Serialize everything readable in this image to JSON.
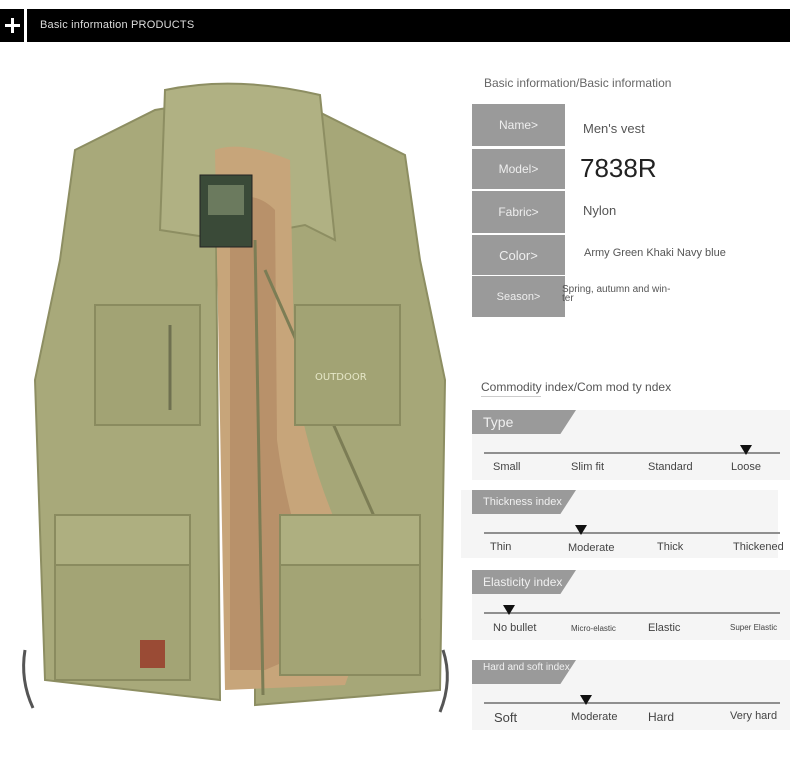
{
  "header": {
    "title": "Basic information PRODUCTS"
  },
  "basic_info": {
    "title": "Basic information/Basic information",
    "rows": [
      {
        "label": "Name>",
        "value": "Men's vest"
      },
      {
        "label": "Model>",
        "value": "7838R"
      },
      {
        "label": "Fabric>",
        "value": "Nylon"
      },
      {
        "label": "Color>",
        "value": "Army Green Khaki Navy blue"
      },
      {
        "label": "Season>",
        "value": "Spring, autumn and win-\nter"
      }
    ]
  },
  "commodity_index": {
    "title": "Commodity index/Com mod ty ndex",
    "indices": [
      {
        "name": "Type",
        "options": [
          "Small",
          "Slim fit",
          "Standard",
          "Loose"
        ],
        "selected": "Loose"
      },
      {
        "name": "Thickness index",
        "options": [
          "Thin",
          "Moderate",
          "Thick",
          "Thickened"
        ],
        "selected": "Moderate"
      },
      {
        "name": "Elasticity index",
        "options": [
          "No bullet",
          "Micro-elastic",
          "Elastic",
          "Super Elastic"
        ],
        "selected": "No bullet"
      },
      {
        "name": "Hard and soft index",
        "options": [
          "Soft",
          "Moderate",
          "Hard",
          "Very hard"
        ],
        "selected": "Moderate"
      }
    ]
  },
  "product_image": {
    "description_icon": "vest-photo",
    "patch_text": "OUTDOOR",
    "colors": {
      "vest": "#a9aa7a",
      "fleece": "#c9a77c",
      "pocket_shadow": "#8c8d60"
    }
  }
}
